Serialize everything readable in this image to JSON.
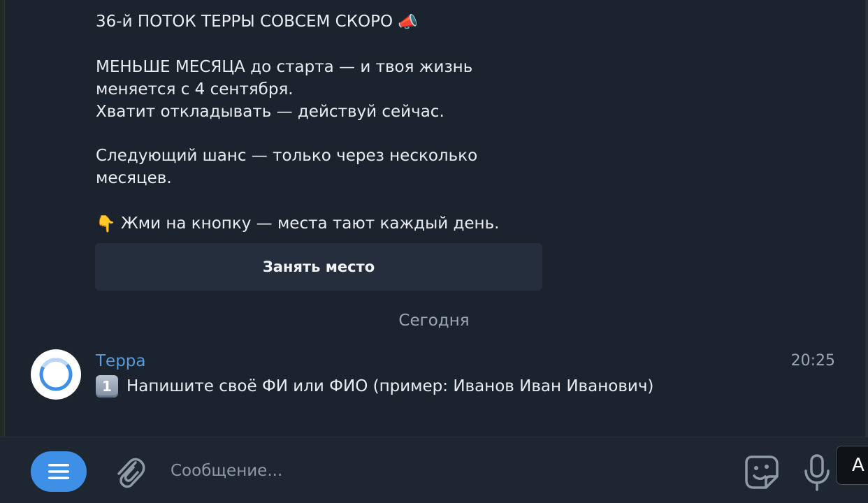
{
  "message": {
    "line1": "36-й ПОТОК ТЕРРЫ СОВСЕМ СКОРО",
    "line1_emoji": "📣",
    "line2": "МЕНЬШЕ МЕСЯЦА до старта — и твоя жизнь",
    "line3": "меняется с 4 сентября.",
    "line4": "Хватит откладывать — действуй сейчас.",
    "line5": "Следующий шанс — только через несколько",
    "line6": "месяцев.",
    "line7_emoji": "👇",
    "line7": "Жми на кнопку — места тают каждый день."
  },
  "inline_button": {
    "label": "Занять место"
  },
  "date_separator": "Сегодня",
  "latest_message": {
    "sender": "Терра",
    "time": "20:25",
    "keycap": "1",
    "text": "Напишите своё ФИ или ФИО (пример: Иванов Иван Иванович)"
  },
  "composer": {
    "placeholder": "Сообщение...",
    "icons": {
      "menu": "menu-icon",
      "attach": "paperclip-icon",
      "sticker": "sticker-icon",
      "mic": "microphone-icon"
    }
  },
  "side_popup": {
    "label": "A"
  },
  "colors": {
    "background": "#1b232e",
    "accent": "#3e8fe6",
    "sender": "#5b9bd9",
    "button_bg": "#242e3d",
    "muted_text": "#9aa7b4"
  }
}
